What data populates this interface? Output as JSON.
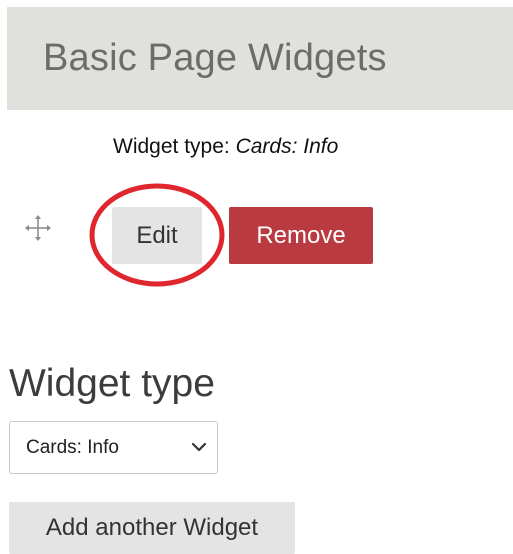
{
  "header": {
    "title": "Basic Page Widgets"
  },
  "widget": {
    "type_label": "Widget type:",
    "type_value": "Cards: Info",
    "edit_label": "Edit",
    "remove_label": "Remove"
  },
  "new_widget": {
    "heading": "Widget type",
    "selected_option": "Cards: Info",
    "add_label": "Add another Widget"
  },
  "icons": {
    "drag": "drag-move-icon",
    "chevron": "chevron-down-icon"
  },
  "colors": {
    "header_bg": "#e0e0dc",
    "remove_bg": "#b93a40",
    "highlight": "#e0262d",
    "button_bg": "#e4e4e4"
  }
}
